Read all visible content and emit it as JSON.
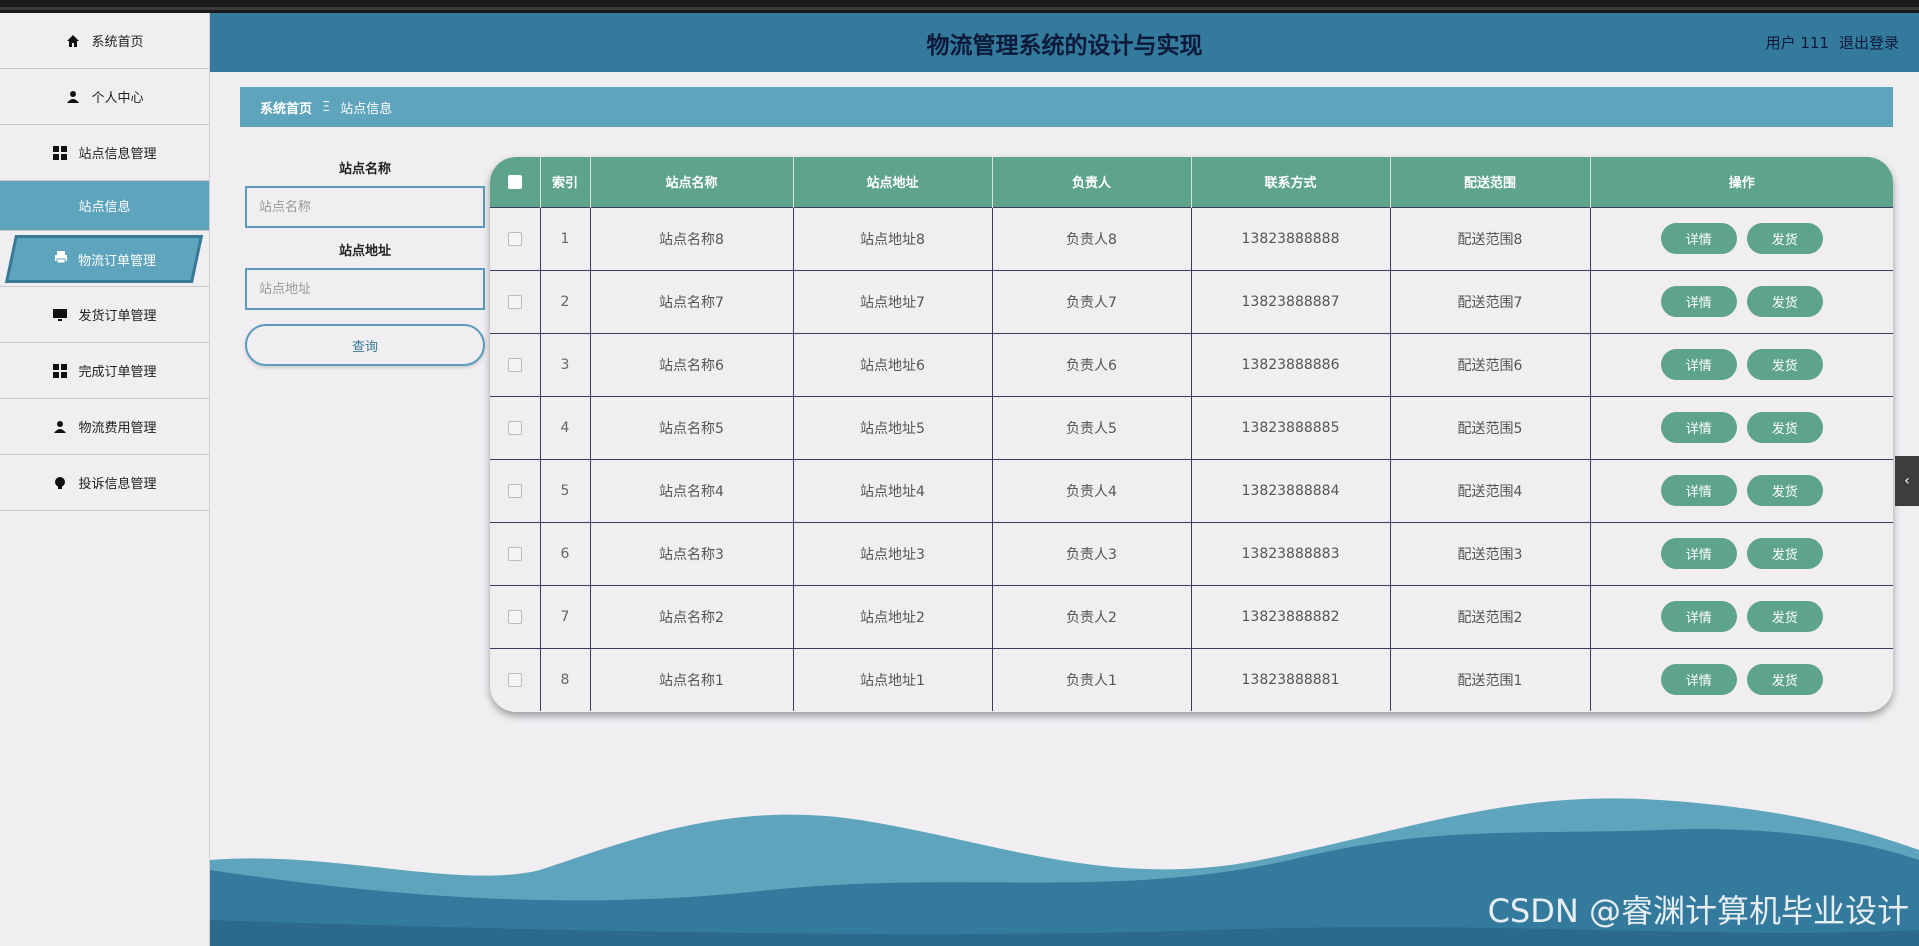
{
  "header": {
    "title": "物流管理系统的设计与实现",
    "user_label": "用户 111",
    "logout_label": "退出登录"
  },
  "sidebar": {
    "items": [
      {
        "label": "系统首页",
        "icon": "home-icon"
      },
      {
        "label": "个人中心",
        "icon": "user-icon"
      },
      {
        "label": "站点信息管理",
        "icon": "grid-icon"
      },
      {
        "label": "站点信息",
        "icon": ""
      },
      {
        "label": "物流订单管理",
        "icon": "printer-icon"
      },
      {
        "label": "发货订单管理",
        "icon": "monitor-icon"
      },
      {
        "label": "完成订单管理",
        "icon": "grid-icon"
      },
      {
        "label": "物流费用管理",
        "icon": "user-icon"
      },
      {
        "label": "投诉信息管理",
        "icon": "bulb-icon"
      }
    ]
  },
  "breadcrumb": {
    "home": "系统首页",
    "separator": "Ξ",
    "current": "站点信息"
  },
  "search": {
    "name_label": "站点名称",
    "name_placeholder": "站点名称",
    "address_label": "站点地址",
    "address_placeholder": "站点地址",
    "query_button": "查询"
  },
  "table": {
    "headers": [
      "索引",
      "站点名称",
      "站点地址",
      "负责人",
      "联系方式",
      "配送范围",
      "操作"
    ],
    "rows": [
      {
        "index": "1",
        "name": "站点名称8",
        "address": "站点地址8",
        "manager": "负责人8",
        "phone": "13823888888",
        "range": "配送范围8"
      },
      {
        "index": "2",
        "name": "站点名称7",
        "address": "站点地址7",
        "manager": "负责人7",
        "phone": "13823888887",
        "range": "配送范围7"
      },
      {
        "index": "3",
        "name": "站点名称6",
        "address": "站点地址6",
        "manager": "负责人6",
        "phone": "13823888886",
        "range": "配送范围6"
      },
      {
        "index": "4",
        "name": "站点名称5",
        "address": "站点地址5",
        "manager": "负责人5",
        "phone": "13823888885",
        "range": "配送范围5"
      },
      {
        "index": "5",
        "name": "站点名称4",
        "address": "站点地址4",
        "manager": "负责人4",
        "phone": "13823888884",
        "range": "配送范围4"
      },
      {
        "index": "6",
        "name": "站点名称3",
        "address": "站点地址3",
        "manager": "负责人3",
        "phone": "13823888883",
        "range": "配送范围3"
      },
      {
        "index": "7",
        "name": "站点名称2",
        "address": "站点地址2",
        "manager": "负责人2",
        "phone": "13823888882",
        "range": "配送范围2"
      },
      {
        "index": "8",
        "name": "站点名称1",
        "address": "站点地址1",
        "manager": "负责人1",
        "phone": "13823888881",
        "range": "配送范围1"
      }
    ],
    "detail_label": "详情",
    "ship_label": "发货"
  },
  "watermark": "CSDN @睿渊计算机毕业设计",
  "colors": {
    "header_bg": "#347a9c",
    "accent_blue": "#5fa4bd",
    "table_green": "#5da48a",
    "page_bg": "#f0eef1"
  }
}
